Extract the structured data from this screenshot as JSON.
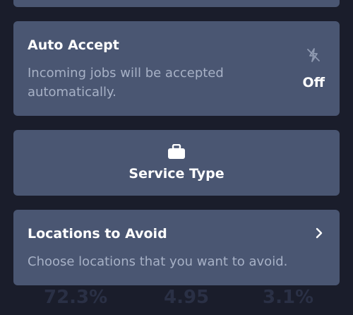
{
  "auto_accept": {
    "title": "Auto Accept",
    "description": "Incoming jobs will be accepted automatically.",
    "status": "Off",
    "icon": "lightning-off-icon"
  },
  "service_type": {
    "title": "Service Type",
    "icon": "briefcase-icon"
  },
  "locations": {
    "title": "Locations to Avoid",
    "description": "Choose locations that you want to avoid.",
    "icon": "chevron-right-icon"
  },
  "stats": [
    "72.3%",
    "4.95",
    "3.1%"
  ],
  "colors": {
    "background": "#1a1d2b",
    "card": "#4a5672",
    "text": "#ffffff",
    "muted_text": "#a7b1c6"
  }
}
